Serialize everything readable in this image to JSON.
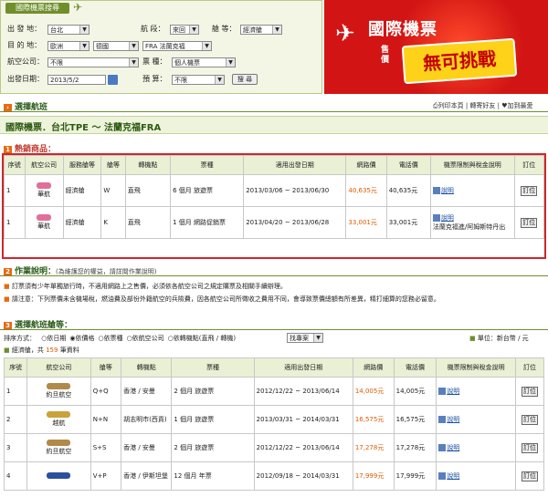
{
  "search": {
    "title": "國際機票搜尋",
    "depart_label": "出 發 地：",
    "depart_value": "台北",
    "trip_label": "航 段：",
    "trip_value": "來回",
    "class_label": "艙 等：",
    "class_value": "經濟艙",
    "dest_label": "目 的 地：",
    "dest_region": "歐洲",
    "dest_country": "德國",
    "dest_city": "FRA 法蘭克福",
    "airline_label": "航空公司：",
    "airline_value": "不限",
    "ticket_label": "票 種：",
    "ticket_value": "個人機票",
    "date_label": "出發日期：",
    "date_value": "2013/5/2",
    "budget_label": "預 算：",
    "budget_value": "不限",
    "search_button": "搜 尋"
  },
  "promo": {
    "title": "國際機票",
    "price_tag": "售價",
    "slogan": "無可挑戰"
  },
  "select_flight": {
    "title": "選擇航班",
    "print_link": "列印本頁",
    "share_link": "轉寄好友",
    "save_link": "加到最愛"
  },
  "route": "國際機票．台北TPE ～ 法蘭克福FRA",
  "hot": {
    "number": "1",
    "title": "熱銷商品：",
    "headers": [
      "序號",
      "航空公司",
      "服務艙等",
      "艙等",
      "轉機點",
      "票種",
      "適用出發日期",
      "網路價",
      "電話價",
      "機票限制與稅金說明",
      "訂位"
    ],
    "rows": [
      {
        "no": "1",
        "airline": "華航",
        "cabin": "經濟艙",
        "class": "W",
        "transfer": "直飛",
        "ticket": "6 個月 旅遊票",
        "dates": "2013/03/06 ~ 2013/06/30",
        "web_price": "40,635元",
        "phone_price": "40,635元",
        "note": "說明",
        "extra": "",
        "book": "訂位"
      },
      {
        "no": "1",
        "airline": "華航",
        "cabin": "經濟艙",
        "class": "K",
        "transfer": "直飛",
        "ticket": "1 個月 網路促銷票",
        "dates": "2013/04/20 ~ 2013/06/28",
        "web_price": "33,001元",
        "phone_price": "33,001元",
        "note": "說明",
        "extra": "法蘭克福進/阿姆斯特丹出",
        "book": "訂位"
      }
    ]
  },
  "instructions": {
    "number": "2",
    "title": "作業說明：",
    "subtitle": "(為維護您的權益，請詳閱作業說明)",
    "line1": "訂票須有少年單獨旅行時，不適用網路上之售價，必須依各航空公司之規定購票及相關手續辦理。",
    "line2": "請注意：下列票價未含機場稅，燃油費及部份外籍航空的兵險費，因各航空公司所徵收之費用不同，會導致票價總額有所差異，精打細算的您務必留意。"
  },
  "choose": {
    "number": "3",
    "title": "選擇航班艙等：",
    "sort_label": "排序方式：",
    "sort_options": [
      "依日期",
      "依價格",
      "依票種",
      "依航空公司",
      "依轉機點(直飛 / 轉機)"
    ],
    "filter_value": "找專案",
    "unit_label": "單位：新台幣 / 元",
    "count_prefix": "經濟艙，共",
    "count": "159",
    "count_suffix": "筆資料",
    "headers": [
      "序號",
      "航空公司",
      "艙等",
      "轉機點",
      "票種",
      "適用出發日期",
      "網路價",
      "電話價",
      "機票限制與稅金說明",
      "訂位"
    ],
    "rows": [
      {
        "no": "1",
        "airline": "約旦航空",
        "class": "Q+Q",
        "transfer": "香港 / 安曼",
        "ticket": "2 個月 旅遊票",
        "dates": "2012/12/22 ~ 2013/06/14",
        "web_price": "14,005元",
        "phone_price": "14,005元",
        "note": "說明",
        "book": "訂位"
      },
      {
        "no": "2",
        "airline": "越航",
        "class": "N+N",
        "transfer": "胡志明市(西貢)",
        "ticket": "1 個月 旅遊票",
        "dates": "2013/03/31 ~ 2014/03/31",
        "web_price": "16,575元",
        "phone_price": "16,575元",
        "note": "說明",
        "book": "訂位"
      },
      {
        "no": "3",
        "airline": "約旦航空",
        "class": "S+S",
        "transfer": "香港 / 安曼",
        "ticket": "2 個月 旅遊票",
        "dates": "2012/12/22 ~ 2013/06/14",
        "web_price": "17,278元",
        "phone_price": "17,278元",
        "note": "說明",
        "book": "訂位"
      },
      {
        "no": "4",
        "airline": "",
        "class": "V+P",
        "transfer": "香港 / 伊斯坦堡",
        "ticket": "12 個月 年票",
        "dates": "2012/09/18 ~ 2014/03/31",
        "web_price": "17,999元",
        "phone_price": "17,999元",
        "note": "說明",
        "book": "訂位"
      }
    ]
  },
  "colors": {
    "accent": "#e56a12",
    "header_green": "#6f8f2c",
    "price": "#e05a00",
    "hot_border": "#d0262b",
    "promo_red": "#d21414"
  }
}
